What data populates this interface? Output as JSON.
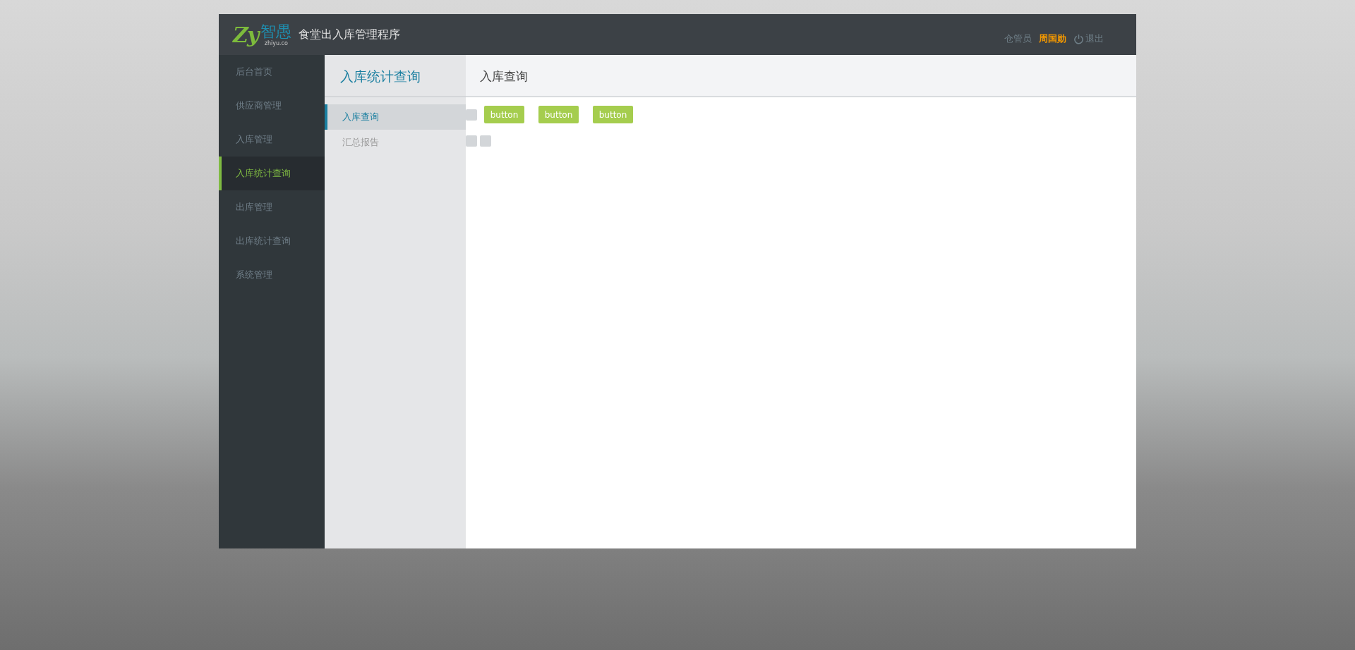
{
  "header": {
    "logo": {
      "mark": "Zy",
      "name": "智愚",
      "domain": "zhiyu.co"
    },
    "title": "食堂出入库管理程序",
    "user": {
      "role": "仓管员",
      "name": "周国勋",
      "logout": "退出"
    }
  },
  "sidebar": {
    "items": [
      {
        "label": "后台首页",
        "selected": false
      },
      {
        "label": "供应商管理",
        "selected": false
      },
      {
        "label": "入库管理",
        "selected": false
      },
      {
        "label": "入库统计查询",
        "selected": true
      },
      {
        "label": "出库管理",
        "selected": false
      },
      {
        "label": "出库统计查询",
        "selected": false
      },
      {
        "label": "系统管理",
        "selected": false
      }
    ]
  },
  "subnav": {
    "title": "入库统计查询",
    "items": [
      {
        "label": "入库查询",
        "selected": true
      },
      {
        "label": "汇总报告",
        "selected": false
      }
    ]
  },
  "content": {
    "title": "入库查询",
    "buttons": [
      "button",
      "button",
      "button"
    ]
  }
}
